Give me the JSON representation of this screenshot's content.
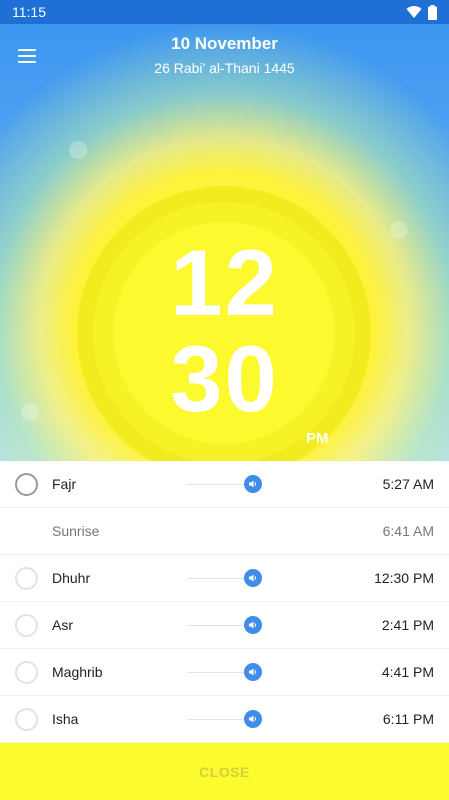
{
  "status_bar": {
    "time": "11:15"
  },
  "header": {
    "date": "10 November",
    "hijri_date": "26 Rabi' al-Thani 1445"
  },
  "clock": {
    "hours": "12",
    "minutes": "30",
    "ampm": "PM"
  },
  "prayers": [
    {
      "name": "Fajr",
      "time": "5:27 AM",
      "has_sound": true,
      "selected": false
    },
    {
      "name": "Sunrise",
      "time": "6:41 AM",
      "has_sound": false
    },
    {
      "name": "Dhuhr",
      "time": "12:30 PM",
      "has_sound": true,
      "selected": false
    },
    {
      "name": "Asr",
      "time": "2:41 PM",
      "has_sound": true,
      "selected": false
    },
    {
      "name": "Maghrib",
      "time": "4:41 PM",
      "has_sound": true,
      "selected": false
    },
    {
      "name": "Isha",
      "time": "6:11 PM",
      "has_sound": true,
      "selected": false
    }
  ],
  "close_button": {
    "label": "CLOSE"
  },
  "colors": {
    "header_blue": "#3d96f0",
    "sun_yellow": "#f7f226",
    "sound_blue": "#3f8de8",
    "close_bar": "#fbfb2d"
  },
  "icons": [
    "wifi-icon",
    "battery-icon",
    "menu-icon",
    "volume-icon"
  ]
}
